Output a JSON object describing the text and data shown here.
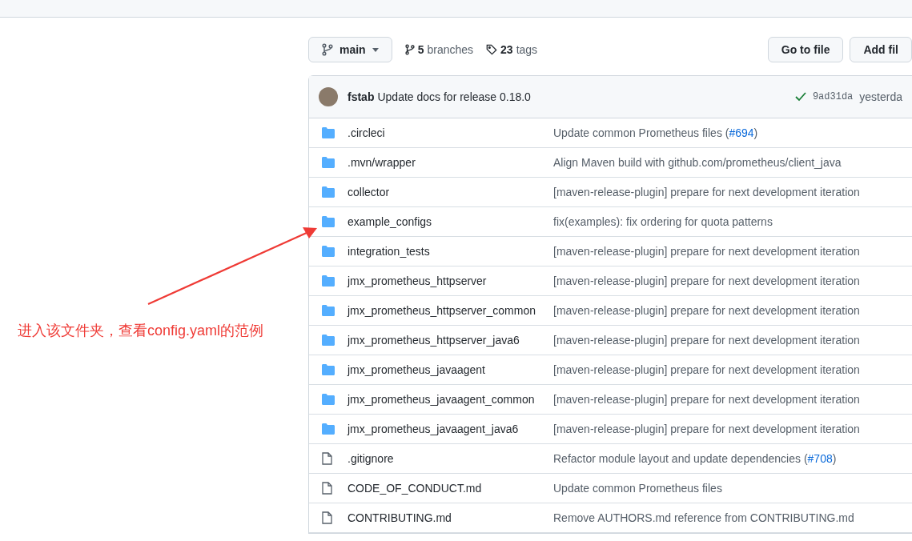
{
  "branch_button": {
    "label": "main"
  },
  "branches": {
    "count": "5",
    "label": "branches"
  },
  "tags": {
    "count": "23",
    "label": "tags"
  },
  "buttons": [
    "Go to file",
    "Add fil"
  ],
  "commit": {
    "author": "fstab",
    "message": "Update docs for release 0.18.0",
    "checks_passed": true,
    "sha": "9ad31da",
    "time": "yesterda"
  },
  "files": [
    {
      "kind": "folder",
      "name": ".circleci",
      "message": "Update common Prometheus files (",
      "link": "#694",
      "after": ")"
    },
    {
      "kind": "folder",
      "name": ".mvn/wrapper",
      "message": "Align Maven build with github.com/prometheus/client_java"
    },
    {
      "kind": "folder",
      "name": "collector",
      "message": "[maven-release-plugin] prepare for next development iteration"
    },
    {
      "kind": "folder",
      "name": "example_configs",
      "message": "fix(examples): fix ordering for quota patterns"
    },
    {
      "kind": "folder",
      "name": "integration_tests",
      "message": "[maven-release-plugin] prepare for next development iteration"
    },
    {
      "kind": "folder",
      "name": "jmx_prometheus_httpserver",
      "message": "[maven-release-plugin] prepare for next development iteration"
    },
    {
      "kind": "folder",
      "name": "jmx_prometheus_httpserver_common",
      "message": "[maven-release-plugin] prepare for next development iteration"
    },
    {
      "kind": "folder",
      "name": "jmx_prometheus_httpserver_java6",
      "message": "[maven-release-plugin] prepare for next development iteration"
    },
    {
      "kind": "folder",
      "name": "jmx_prometheus_javaagent",
      "message": "[maven-release-plugin] prepare for next development iteration"
    },
    {
      "kind": "folder",
      "name": "jmx_prometheus_javaagent_common",
      "message": "[maven-release-plugin] prepare for next development iteration"
    },
    {
      "kind": "folder",
      "name": "jmx_prometheus_javaagent_java6",
      "message": "[maven-release-plugin] prepare for next development iteration"
    },
    {
      "kind": "file",
      "name": ".gitignore",
      "message": "Refactor module layout and update dependencies (",
      "link": "#708",
      "after": ")"
    },
    {
      "kind": "file",
      "name": "CODE_OF_CONDUCT.md",
      "message": "Update common Prometheus files"
    },
    {
      "kind": "file",
      "name": "CONTRIBUTING.md",
      "message": "Remove AUTHORS.md reference from CONTRIBUTING.md"
    }
  ],
  "annotation": {
    "text": "进入该文件夹，查看config.yaml的范例"
  }
}
